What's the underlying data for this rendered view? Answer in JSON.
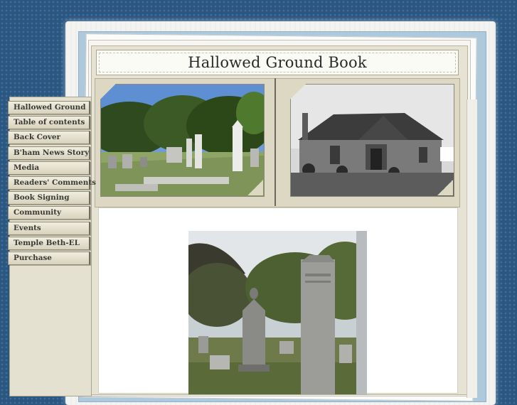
{
  "header": {
    "title": "Hallowed Ground Book"
  },
  "nav": {
    "items": [
      {
        "label": "Hallowed Ground"
      },
      {
        "label": "Table of contents"
      },
      {
        "label": "Back Cover"
      },
      {
        "label": "B'ham News Story"
      },
      {
        "label": "Media"
      },
      {
        "label": "Readers' Comments"
      },
      {
        "label": "Book Signing"
      },
      {
        "label": "Community"
      },
      {
        "label": "Events"
      },
      {
        "label": "Temple Beth-EL"
      },
      {
        "label": "Purchase"
      }
    ]
  },
  "photos": {
    "left": "cemetery-color-photo",
    "right": "temple-building-bw-photo",
    "main": "cemetery-monuments-photo"
  }
}
